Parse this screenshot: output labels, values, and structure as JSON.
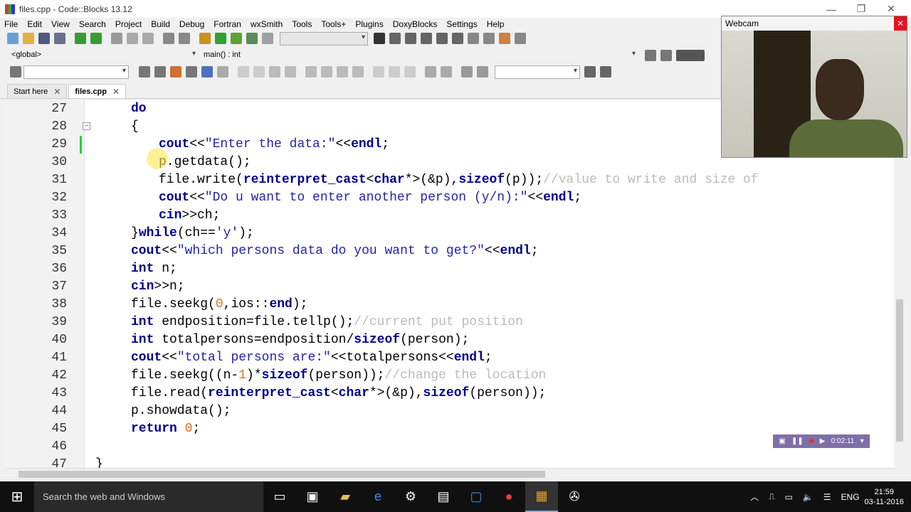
{
  "window": {
    "title": "files.cpp - Code::Blocks 13.12",
    "controls": [
      "—",
      "❐",
      "✕"
    ]
  },
  "menu": [
    "File",
    "Edit",
    "View",
    "Search",
    "Project",
    "Build",
    "Debug",
    "Fortran",
    "wxSmith",
    "Tools",
    "Tools+",
    "Plugins",
    "DoxyBlocks",
    "Settings",
    "Help"
  ],
  "scope": {
    "global": "<global>",
    "function": "main() : int"
  },
  "tabs": [
    {
      "label": "Start here",
      "close": "✕"
    },
    {
      "label": "files.cpp",
      "close": "✕"
    }
  ],
  "code_lines": [
    {
      "n": "27",
      "indent": 0,
      "text": "do"
    },
    {
      "n": "28",
      "indent": 0,
      "text": "{"
    },
    {
      "n": "29",
      "indent": 1,
      "text": "cout<<\"Enter the data:\"<<endl;"
    },
    {
      "n": "30",
      "indent": 1,
      "text": "p.getdata();"
    },
    {
      "n": "31",
      "indent": 1,
      "text": "file.write(reinterpret_cast<char*>(&p),sizeof(p));//value to write and size of"
    },
    {
      "n": "32",
      "indent": 1,
      "text": "cout<<\"Do u want to enter another person (y/n):\"<<endl;"
    },
    {
      "n": "33",
      "indent": 1,
      "text": "cin>>ch;"
    },
    {
      "n": "34",
      "indent": 0,
      "text": "}while(ch=='y');"
    },
    {
      "n": "35",
      "indent": 0,
      "text": "cout<<\"which persons data do you want to get?\"<<endl;"
    },
    {
      "n": "36",
      "indent": 0,
      "text": "int n;"
    },
    {
      "n": "37",
      "indent": 0,
      "text": "cin>>n;"
    },
    {
      "n": "38",
      "indent": 0,
      "text": "file.seekg(0,ios::end);"
    },
    {
      "n": "39",
      "indent": 0,
      "text": "int endposition=file.tellp();//current put position"
    },
    {
      "n": "40",
      "indent": 0,
      "text": "int totalpersons=endposition/sizeof(person);"
    },
    {
      "n": "41",
      "indent": 0,
      "text": "cout<<\"total persons are:\"<<totalpersons<<endl;"
    },
    {
      "n": "42",
      "indent": 0,
      "text": "file.seekg((n-1)*sizeof(person));//change the location"
    },
    {
      "n": "43",
      "indent": 0,
      "text": "file.read(reinterpret_cast<char*>(&p),sizeof(person));"
    },
    {
      "n": "44",
      "indent": 0,
      "text": "p.showdata();"
    },
    {
      "n": "45",
      "indent": 0,
      "text": "return 0;"
    },
    {
      "n": "46",
      "indent": 0,
      "text": ""
    },
    {
      "n": "47",
      "indent": -1,
      "text": "}"
    }
  ],
  "webcam": {
    "title": "Webcam",
    "close": "✕"
  },
  "recorder": {
    "time": "0:02:11"
  },
  "taskbar": {
    "search_placeholder": "Search the web and Windows",
    "language": "ENG",
    "time": "21:59",
    "date": "03-11-2016"
  }
}
